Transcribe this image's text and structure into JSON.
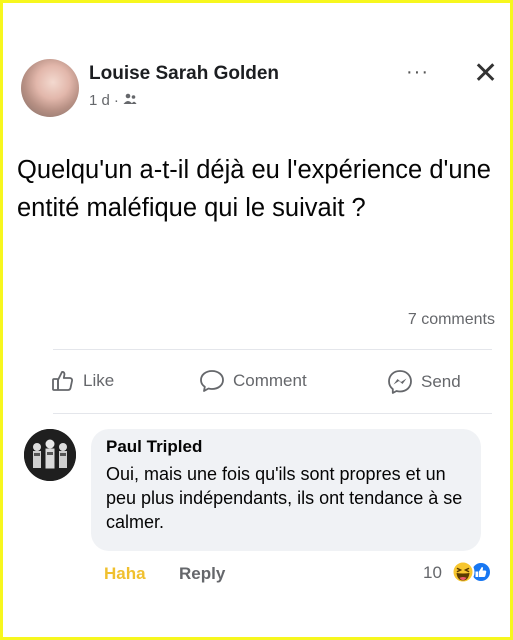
{
  "post": {
    "author": "Louise Sarah Golden",
    "time": "1 d",
    "separator": "·",
    "text": "Quelqu'un a-t-il déjà eu l'expérience d'une entité maléfique qui le suivait ?",
    "more_label": "···",
    "close_label": "✕",
    "comments_count": "7 comments"
  },
  "actions": {
    "like": "Like",
    "comment": "Comment",
    "send": "Send"
  },
  "comment": {
    "author": "Paul Tripled",
    "text": "Oui, mais une fois qu'ils sont propres et un peu plus indépendants, ils ont tendance à se calmer.",
    "reaction_label": "Haha",
    "reply_label": "Reply",
    "reaction_count": "10"
  },
  "icons": {
    "audience": "friends-icon",
    "like": "thumbs-up-icon",
    "comment": "speech-bubble-icon",
    "send": "messenger-icon",
    "reactions": [
      "haha-emoji-icon",
      "like-reaction-icon"
    ]
  },
  "colors": {
    "frame": "#f7f71e",
    "haha": "#f0c02e",
    "like_blue": "#1877f2",
    "muted": "#65676b"
  }
}
